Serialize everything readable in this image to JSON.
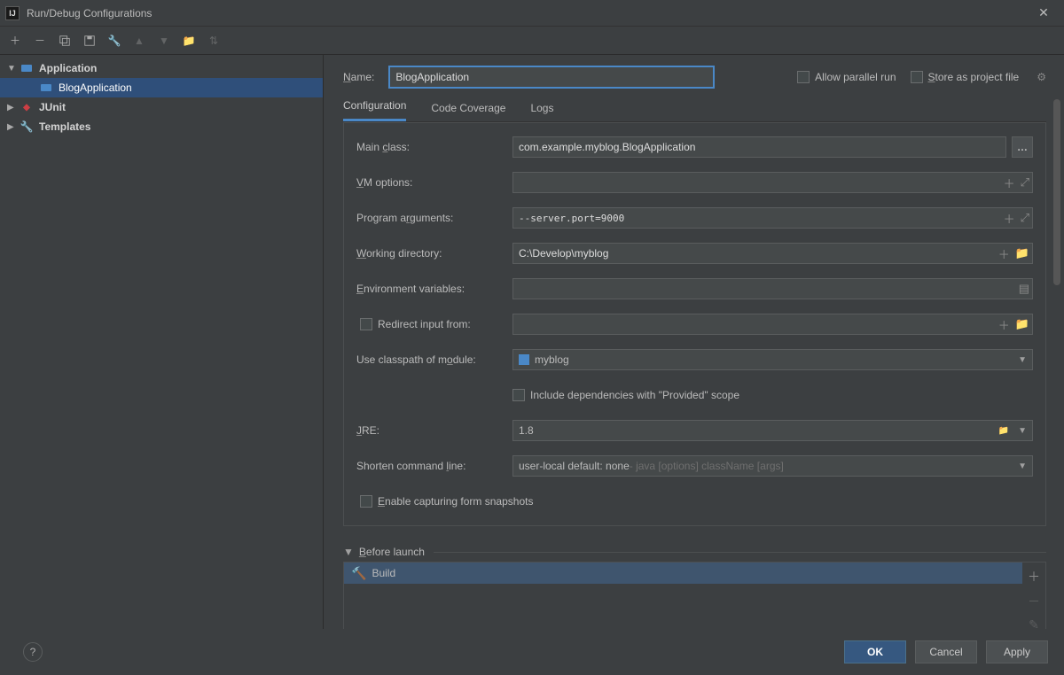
{
  "window": {
    "title": "Run/Debug Configurations"
  },
  "tree": {
    "application": "Application",
    "blogapp": "BlogApplication",
    "junit": "JUnit",
    "templates": "Templates"
  },
  "top": {
    "name_label": "Name:",
    "name_value": "BlogApplication",
    "allow_parallel": "Allow parallel run",
    "store_project": "Store as project file"
  },
  "tabs": {
    "conf": "Configuration",
    "cov": "Code Coverage",
    "logs": "Logs"
  },
  "form": {
    "main_class_l": "Main class:",
    "main_class_v": "com.example.myblog.BlogApplication",
    "vm_l": "VM options:",
    "vm_v": "",
    "pa_l": "Program arguments:",
    "pa_v": "--server.port=9000",
    "wd_l": "Working directory:",
    "wd_v": "C:\\Develop\\myblog",
    "env_l": "Environment variables:",
    "env_v": "",
    "redir_l": "Redirect input from:",
    "redir_v": "",
    "cp_l": "Use classpath of module:",
    "cp_v": "myblog",
    "provided_l": "Include dependencies with \"Provided\" scope",
    "jre_l": "JRE:",
    "jre_v": "1.8",
    "shorten_l": "Shorten command line:",
    "shorten_v": "user-local default: none",
    "shorten_hint": " - java [options] className [args]",
    "snap_l": "Enable capturing form snapshots"
  },
  "before": {
    "header": "Before launch",
    "build": "Build"
  },
  "footer": {
    "ok": "OK",
    "cancel": "Cancel",
    "apply": "Apply"
  }
}
